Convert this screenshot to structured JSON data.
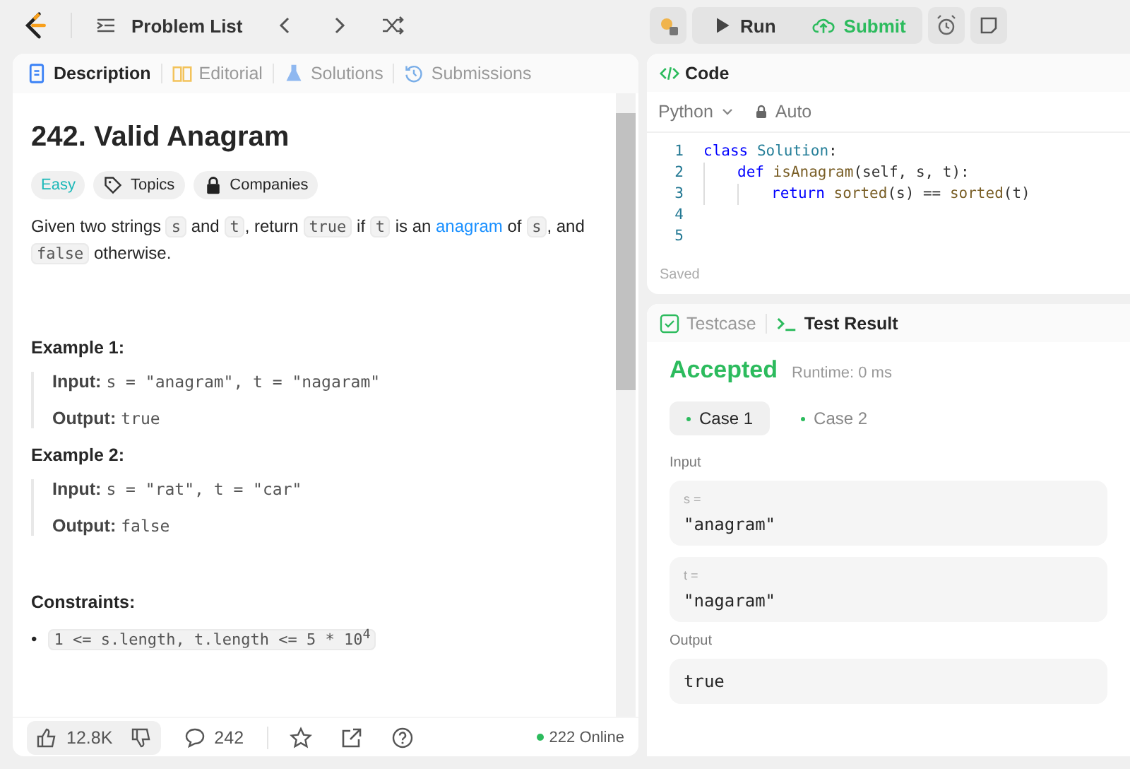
{
  "topbar": {
    "title": "Problem List",
    "run": "Run",
    "submit": "Submit"
  },
  "left_tabs": [
    {
      "label": "Description",
      "selected": true
    },
    {
      "label": "Editorial",
      "selected": false
    },
    {
      "label": "Solutions",
      "selected": false
    },
    {
      "label": "Submissions",
      "selected": false
    }
  ],
  "problem": {
    "title": "242. Valid Anagram",
    "difficulty": "Easy",
    "topics": "Topics",
    "companies": "Companies",
    "description": [
      {
        "kind": "text",
        "text": "Given two strings "
      },
      {
        "kind": "code",
        "text": "s"
      },
      {
        "kind": "text",
        "text": " and "
      },
      {
        "kind": "code",
        "text": "t"
      },
      {
        "kind": "text",
        "text": ", return "
      },
      {
        "kind": "code",
        "text": "true"
      },
      {
        "kind": "text",
        "text": " if "
      },
      {
        "kind": "code",
        "text": "t"
      },
      {
        "kind": "text",
        "text": " is an "
      },
      {
        "kind": "link",
        "text": "anagram"
      },
      {
        "kind": "text",
        "text": " of "
      },
      {
        "kind": "code",
        "text": "s"
      },
      {
        "kind": "text",
        "text": ", and "
      },
      {
        "kind": "code",
        "text": "false"
      },
      {
        "kind": "text",
        "text": " otherwise."
      }
    ],
    "examples": [
      {
        "title": "Example 1:",
        "input_label": "Input:",
        "input": "s = \"anagram\", t = \"nagaram\"",
        "output_label": "Output:",
        "output": "true"
      },
      {
        "title": "Example 2:",
        "input_label": "Input:",
        "input": "s = \"rat\", t = \"car\"",
        "output_label": "Output:",
        "output": "false"
      }
    ],
    "constraints_title": "Constraints:",
    "constraints": [
      {
        "bullet": "•",
        "text": "1 <= s.length, t.length <= 5 * 10$^{4}$"
      }
    ]
  },
  "footer": {
    "likes": "12.8K",
    "comments": "242",
    "online": "222 Online"
  },
  "code": {
    "title": "Code",
    "language": "Python",
    "mode": "Auto",
    "status": "Saved",
    "lines": [
      {
        "number": "1",
        "tokens": [
          {
            "kind": "keyword",
            "text": "class "
          },
          {
            "kind": "class",
            "text": "Solution"
          },
          {
            "kind": "plain",
            "text": ":"
          }
        ],
        "children": [
          {
            "number": "2",
            "tokens": [
              {
                "kind": "keyword",
                "text": "def "
              },
              {
                "kind": "func",
                "text": "isAnagram"
              },
              {
                "kind": "plain",
                "text": "(self, s, t):"
              }
            ],
            "children": [
              {
                "number": "3",
                "tokens": [
                  {
                    "kind": "keyword",
                    "text": "return "
                  },
                  {
                    "kind": "func",
                    "text": "sorted"
                  },
                  {
                    "kind": "plain",
                    "text": "(s) == "
                  },
                  {
                    "kind": "func",
                    "text": "sorted"
                  },
                  {
                    "kind": "plain",
                    "text": "(t)"
                  }
                ]
              }
            ]
          }
        ]
      },
      {
        "number": "4"
      },
      {
        "number": "5"
      }
    ]
  },
  "result_tabs": [
    {
      "label": "Testcase",
      "selected": false
    },
    {
      "label": "Test Result",
      "selected": true
    }
  ],
  "result": {
    "verdict": "Accepted",
    "runtime": "Runtime: 0 ms",
    "cases": [
      {
        "label": "Case 1",
        "selected": true
      },
      {
        "label": "Case 2",
        "selected": false
      }
    ],
    "input_label": "Input",
    "inputs": [
      {
        "name": "s =",
        "value": "\"anagram\""
      },
      {
        "name": "t =",
        "value": "\"nagaram\""
      }
    ],
    "output_label": "Output",
    "output": "true"
  }
}
